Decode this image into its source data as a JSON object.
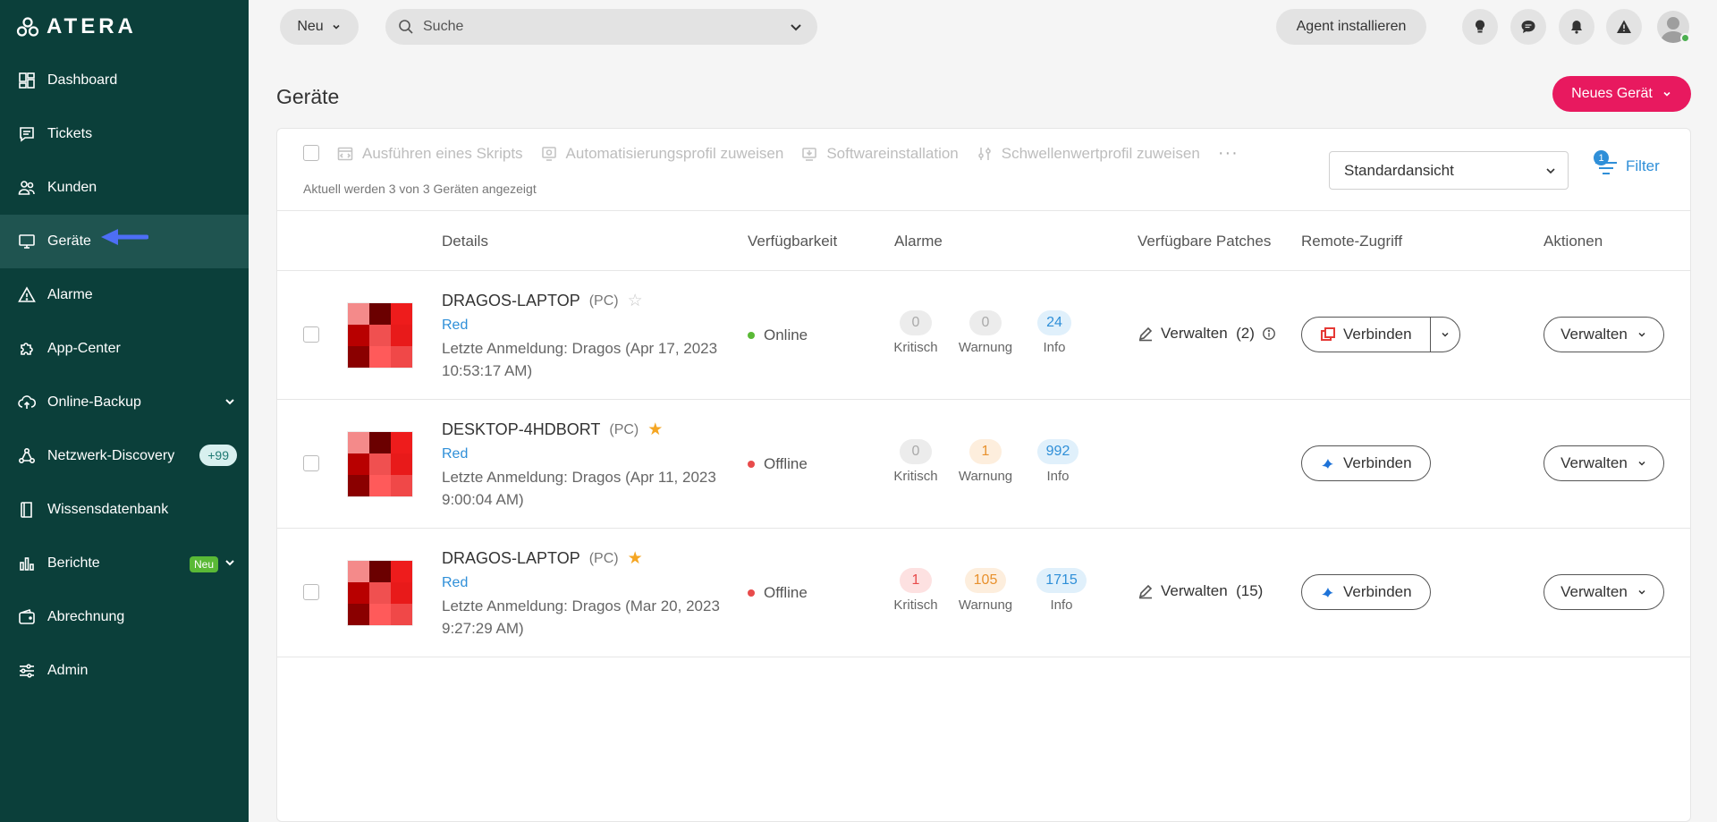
{
  "app": {
    "logo_text": "ATERA"
  },
  "sidebar": {
    "items": [
      {
        "label": "Dashboard"
      },
      {
        "label": "Tickets"
      },
      {
        "label": "Kunden"
      },
      {
        "label": "Geräte"
      },
      {
        "label": "Alarme"
      },
      {
        "label": "App-Center"
      },
      {
        "label": "Online-Backup"
      },
      {
        "label": "Netzwerk-Discovery",
        "badge": "+99"
      },
      {
        "label": "Wissensdatenbank"
      },
      {
        "label": "Berichte",
        "badge": "Neu"
      },
      {
        "label": "Abrechnung"
      },
      {
        "label": "Admin"
      }
    ]
  },
  "topbar": {
    "new_label": "Neu",
    "search_placeholder": "Suche",
    "agent_label": "Agent installieren"
  },
  "page": {
    "title": "Geräte",
    "new_device_label": "Neues Gerät"
  },
  "toolbar": {
    "actions": [
      "Ausführen eines Skripts",
      "Automatisierungsprofil zuweisen",
      "Softwareinstallation",
      "Schwellenwertprofil zuweisen"
    ],
    "more": "···",
    "info": "Aktuell werden 3 von 3 Geräten angezeigt",
    "view_select": "Standardansicht",
    "filter_label": "Filter",
    "filter_count": "1"
  },
  "table": {
    "headers": [
      "Details",
      "Verfügbarkeit",
      "Alarme",
      "Verfügbare Patches",
      "Remote-Zugriff",
      "Aktionen"
    ],
    "alarm_labels": [
      "Kritisch",
      "Warnung",
      "Info"
    ],
    "rows": [
      {
        "name": "DRAGOS-LAPTOP",
        "type": "(PC)",
        "starred": false,
        "tag": "Red",
        "login": "Letzte Anmeldung: Dragos (Apr 17, 2023 10:53:17 AM)",
        "status": "Online",
        "critical": "0",
        "warning": "0",
        "info": "24",
        "patches": "Verwalten  (2)",
        "patch_info": true,
        "connect": "Verbinden",
        "connect_split": true,
        "manage": "Verwalten"
      },
      {
        "name": "DESKTOP-4HDBORT",
        "type": "(PC)",
        "starred": true,
        "tag": "Red",
        "login": "Letzte Anmeldung: Dragos (Apr 11, 2023 9:00:04 AM)",
        "status": "Offline",
        "critical": "0",
        "warning": "1",
        "info": "992",
        "patches": "",
        "patch_info": false,
        "connect": "Verbinden",
        "connect_split": false,
        "manage": "Verwalten"
      },
      {
        "name": "DRAGOS-LAPTOP",
        "type": "(PC)",
        "starred": true,
        "tag": "Red",
        "login": "Letzte Anmeldung: Dragos (Mar 20, 2023 9:27:29 AM)",
        "status": "Offline",
        "critical": "1",
        "warning": "105",
        "info": "1715",
        "patches": "Verwalten  (15)",
        "patch_info": false,
        "connect": "Verbinden",
        "connect_split": false,
        "manage": "Verwalten"
      }
    ]
  },
  "colors": {
    "sidebar_bg": "#0b3f3a",
    "accent_pink": "#e8195f",
    "link_blue": "#2f8fd8",
    "online": "#5ab936",
    "offline": "#e84b4b",
    "star": "#f5a623"
  }
}
